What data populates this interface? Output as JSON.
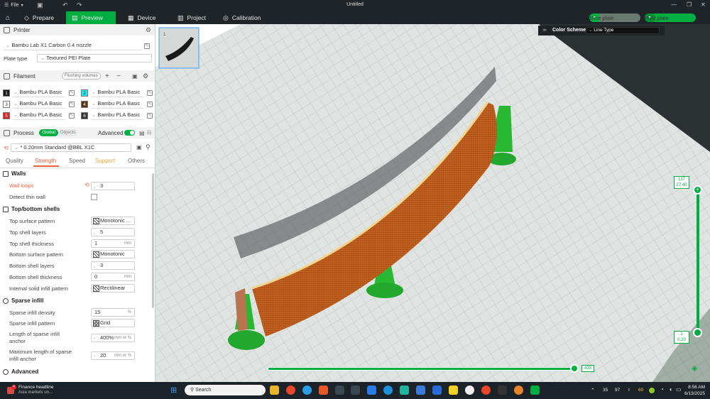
{
  "titlebar": {
    "file_menu": "File",
    "title": "Untitled"
  },
  "tabs": [
    {
      "label": "Prepare",
      "icon": "prepare-icon"
    },
    {
      "label": "Preview",
      "icon": "preview-icon",
      "active": true
    },
    {
      "label": "Device",
      "icon": "device-icon"
    },
    {
      "label": "Project",
      "icon": "project-icon"
    },
    {
      "label": "Calibration",
      "icon": "calibration-icon"
    }
  ],
  "actions": {
    "slice": "Slice plate",
    "print": "Print plate"
  },
  "printer": {
    "section": "Printer",
    "name": "Bambu Lab X1 Carbon 0.4 nozzle",
    "plate_type_label": "Plate type",
    "plate_type": "Textured PEI Plate"
  },
  "filament": {
    "section": "Filament",
    "flushing": "Flushing volumes",
    "items": [
      {
        "num": "1",
        "name": "Bambu PLA Basic",
        "color": "#1a1a1a"
      },
      {
        "num": "2",
        "name": "Bambu PLA Basic",
        "color": "#1ee8f0"
      },
      {
        "num": "3",
        "name": "Bambu PLA Basic",
        "color": "#ffffff"
      },
      {
        "num": "4",
        "name": "Bambu PLA Basic",
        "color": "#5a3311"
      },
      {
        "num": "5",
        "name": "Bambu PLA Basic",
        "color": "#e62020"
      },
      {
        "num": "6",
        "name": "Bambu PLA Basic",
        "color": "#333333"
      }
    ]
  },
  "process": {
    "section": "Process",
    "toggle_global": "Global",
    "toggle_objects": "Objects",
    "advanced": "Advanced",
    "preset": "* 0.20mm Standard @BBL X1C",
    "tabs": [
      "Quality",
      "Strength",
      "Speed",
      "Support",
      "Others"
    ]
  },
  "strength": {
    "walls": "Walls",
    "wall_loops_label": "Wall loops",
    "wall_loops": "3",
    "detect_thin_wall": "Detect thin wall",
    "top_bottom": "Top/bottom shells",
    "top_surface_pattern_label": "Top surface pattern",
    "top_surface_pattern": "Monotonic ...",
    "top_shell_layers_label": "Top shell layers",
    "top_shell_layers": "5",
    "top_shell_thickness_label": "Top shell thickness",
    "top_shell_thickness": "1",
    "bottom_surface_pattern_label": "Bottom surface pattern",
    "bottom_surface_pattern": "Monotonic",
    "bottom_shell_layers_label": "Bottom shell layers",
    "bottom_shell_layers": "3",
    "bottom_shell_thickness_label": "Bottom shell thickness",
    "bottom_shell_thickness": "0",
    "internal_solid_label": "Internal solid infill pattern",
    "internal_solid": "Rectilinear",
    "sparse": "Sparse infill",
    "sparse_density_label": "Sparse infill density",
    "sparse_density": "15",
    "sparse_pattern_label": "Sparse infill pattern",
    "sparse_pattern": "Grid",
    "sparse_anchor_label_1": "Length of sparse infill",
    "sparse_anchor_label_2": "anchor",
    "sparse_anchor": "400%",
    "sparse_anchor_max_label_1": "Maximum length of sparse",
    "sparse_anchor_max_label_2": "infill anchor",
    "sparse_anchor_max": "20",
    "advanced_group": "Advanced",
    "unit_mm": "mm",
    "unit_pct": "%",
    "unit_mm_or_pct": "mm or %"
  },
  "viewport": {
    "color_scheme_label": "Color Scheme",
    "color_scheme_value": "Line Type",
    "layer_top_num": "137",
    "layer_top_height": "27.40",
    "layer_bottom_num": "1",
    "layer_bottom_height": "0.20",
    "move_value": "433",
    "thumbnail_num": "1"
  },
  "taskbar": {
    "news_title": "Finance headline",
    "news_sub": "Asia markets un...",
    "news_badge": "4",
    "search": "Search",
    "tray_a": "35",
    "tray_b": "97",
    "tray_c": "I",
    "tray_d": "60",
    "time": "8:56 AM",
    "date": "6/13/2025"
  }
}
